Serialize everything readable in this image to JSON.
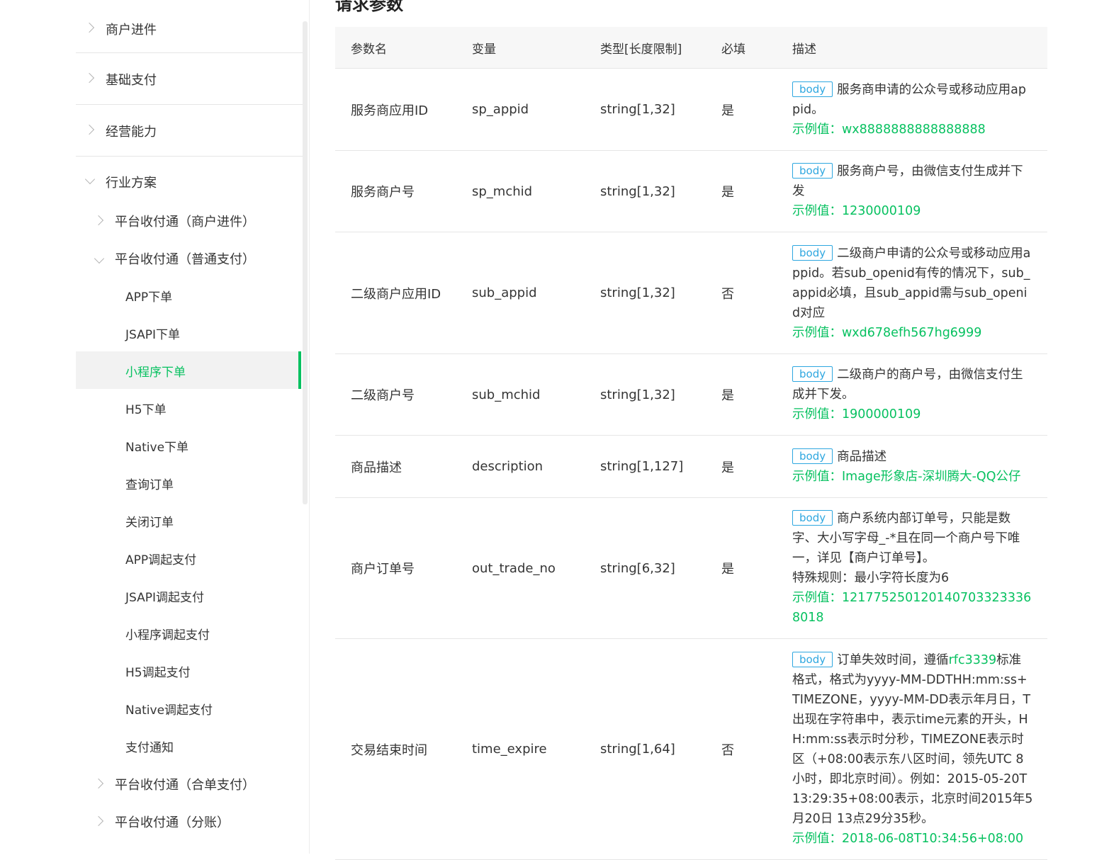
{
  "sidebar": {
    "categories": [
      {
        "label": "商户进件"
      },
      {
        "label": "基础支付"
      },
      {
        "label": "经营能力"
      },
      {
        "label": "行业方案"
      }
    ],
    "subs": [
      {
        "label": "平台收付通（商户进件）"
      },
      {
        "label": "平台收付通（普通支付）"
      },
      {
        "label": "平台收付通（合单支付）"
      },
      {
        "label": "平台收付通（分账）"
      }
    ],
    "leaves": [
      {
        "label": "APP下单"
      },
      {
        "label": "JSAPI下单"
      },
      {
        "label": "小程序下单"
      },
      {
        "label": "H5下单"
      },
      {
        "label": "Native下单"
      },
      {
        "label": "查询订单"
      },
      {
        "label": "关闭订单"
      },
      {
        "label": "APP调起支付"
      },
      {
        "label": "JSAPI调起支付"
      },
      {
        "label": "小程序调起支付"
      },
      {
        "label": "H5调起支付"
      },
      {
        "label": "Native调起支付"
      },
      {
        "label": "支付通知"
      }
    ],
    "active_leaf": "小程序下单"
  },
  "main": {
    "section_title": "请求参数",
    "headers": [
      "参数名",
      "变量",
      "类型[长度限制]",
      "必填",
      "描述"
    ],
    "tag_label": "body",
    "rows": [
      {
        "name": "服务商应用ID",
        "var": "sp_appid",
        "type": "string[1,32]",
        "required": "是",
        "desc": "服务商申请的公众号或移动应用appid。",
        "example": "示例值：wx8888888888888888"
      },
      {
        "name": "服务商户号",
        "var": "sp_mchid",
        "type": "string[1,32]",
        "required": "是",
        "desc": "服务商户号，由微信支付生成并下发",
        "example": "示例值：1230000109"
      },
      {
        "name": "二级商户应用ID",
        "var": "sub_appid",
        "type": "string[1,32]",
        "required": "否",
        "desc": "二级商户申请的公众号或移动应用appid。若sub_openid有传的情况下，sub_appid必填，且sub_appid需与sub_openid对应",
        "example": "示例值：wxd678efh567hg6999"
      },
      {
        "name": "二级商户号",
        "var": "sub_mchid",
        "type": "string[1,32]",
        "required": "是",
        "desc": "二级商户的商户号，由微信支付生成并下发。",
        "example": "示例值：1900000109"
      },
      {
        "name": "商品描述",
        "var": "description",
        "type": "string[1,127]",
        "required": "是",
        "desc": "商品描述",
        "example": "示例值：Image形象店-深圳腾大-QQ公仔"
      },
      {
        "name": "商户订单号",
        "var": "out_trade_no",
        "type": "string[6,32]",
        "required": "是",
        "desc": "商户系统内部订单号，只能是数字、大小写字母_-*且在同一个商户号下唯一，详见【商户订单号】。",
        "extra": "特殊规则：最小字符长度为6",
        "example": "示例值：1217752501201407033233368018"
      },
      {
        "name": "交易结束时间",
        "var": "time_expire",
        "type": "string[1,64]",
        "required": "否",
        "desc_pre": "订单失效时间，遵循",
        "desc_link": "rfc3339",
        "desc": "标准格式，格式为yyyy-MM-DDTHH:mm:ss+TIMEZONE，yyyy-MM-DD表示年月日，T出现在字符串中，表示time元素的开头，HH:mm:ss表示时分秒，TIMEZONE表示时区（+08:00表示东八区时间，领先UTC 8小时，即北京时间）。例如：2015-05-20T13:29:35+08:00表示，北京时间2015年5月20日 13点29分35秒。",
        "example": "示例值：2018-06-08T10:34:56+08:00"
      }
    ]
  }
}
